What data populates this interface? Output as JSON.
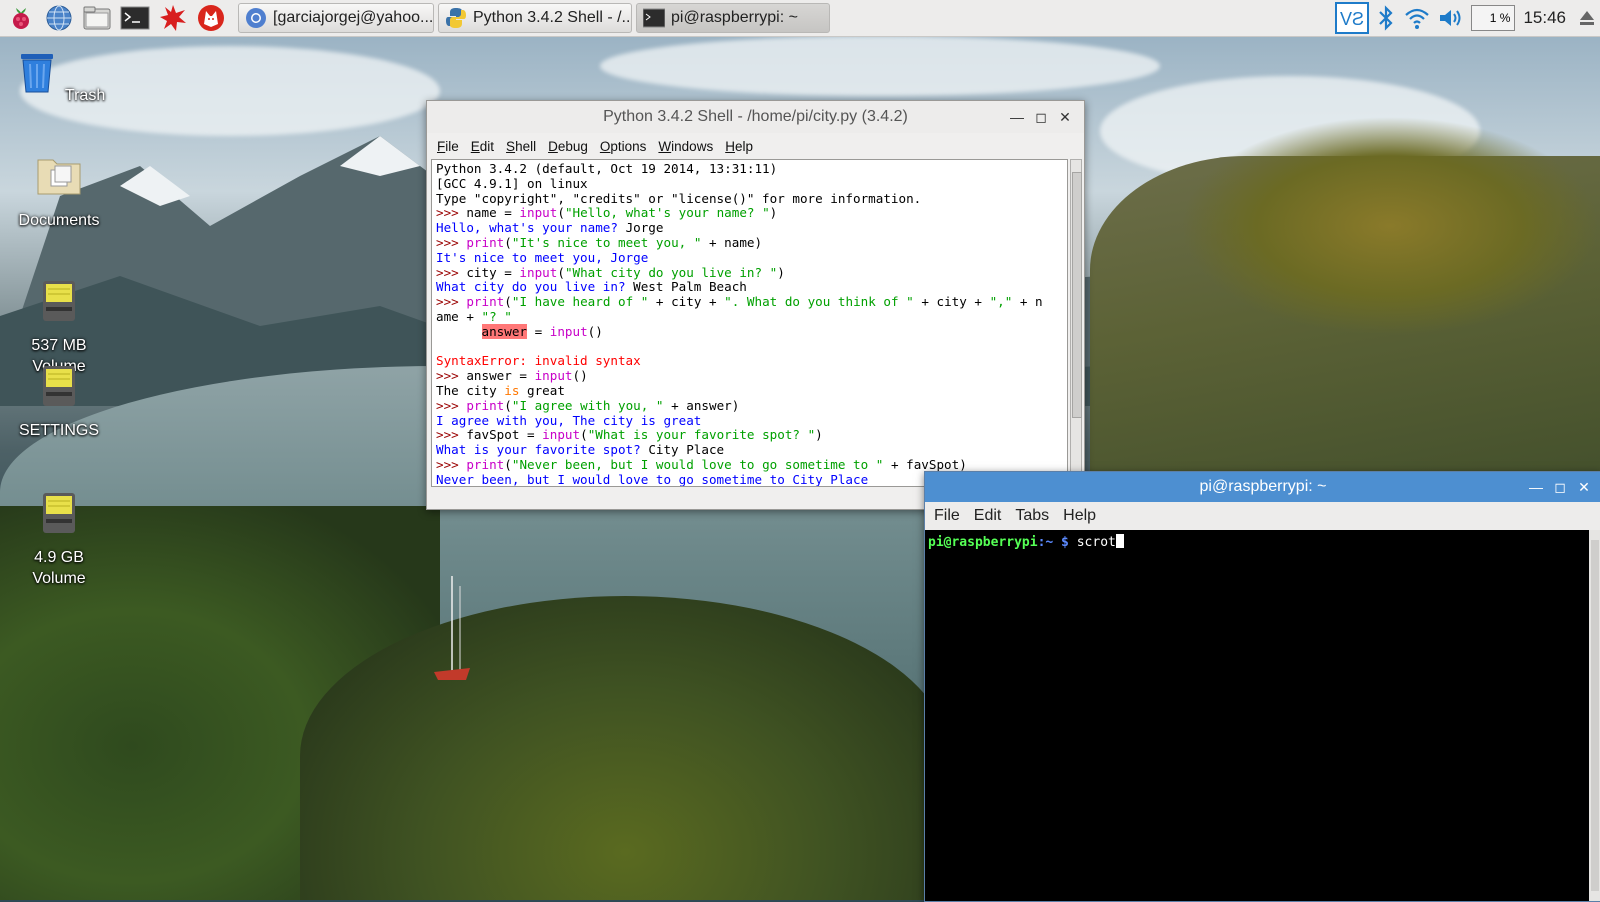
{
  "taskbar": {
    "launchers": [
      "raspberry-menu-icon",
      "web-browser-icon",
      "file-manager-icon",
      "terminal-icon",
      "mathematica-icon",
      "wolfram-icon"
    ],
    "tasks": [
      {
        "label": "[garciajorgej@yahoo...",
        "icon": "chromium-icon"
      },
      {
        "label": "Python 3.4.2 Shell - /...",
        "icon": "python-icon"
      },
      {
        "label": "pi@raspberrypi: ~",
        "icon": "terminal-icon"
      }
    ],
    "tray": {
      "cpu": "1 %",
      "clock": "15:46"
    }
  },
  "desktop_icons": [
    {
      "label": "Trash"
    },
    {
      "label": "Documents"
    },
    {
      "label": "537 MB\nVolume"
    },
    {
      "label": "SETTINGS"
    },
    {
      "label": "4.9 GB\nVolume"
    }
  ],
  "idle": {
    "title": "Python 3.4.2 Shell - /home/pi/city.py (3.4.2)",
    "menu": [
      "File",
      "Edit",
      "Shell",
      "Debug",
      "Options",
      "Windows",
      "Help"
    ],
    "lines": {
      "l1": "Python 3.4.2 (default, Oct 19 2014, 13:31:11)",
      "l2": "[GCC 4.9.1] on linux",
      "l3": "Type \"copyright\", \"credits\" or \"license()\" for more information.",
      "p": ">>> ",
      "l4a": "name = ",
      "l4b": "input",
      "l4c": "(",
      "l4d": "\"Hello, what's your name? \"",
      "l4e": ")",
      "l5a": "Hello, what's your name? ",
      "l5b": "Jorge",
      "l6b": "print",
      "l6c": "(",
      "l6d": "\"It's nice to meet you, \"",
      "l6e": " + name)",
      "l7": "It's nice to meet you, Jorge",
      "l8a": "city = ",
      "l8b": "input",
      "l8c": "(",
      "l8d": "\"What city do you live in? \"",
      "l8e": ")",
      "l9a": "What city do you live in? ",
      "l9b": "West Palm Beach",
      "l10b": "print",
      "l10c": "(",
      "l10d": "\"I have heard of \"",
      "l10e": " + city + ",
      "l10f": "\". What do you think of \"",
      "l10g": " + city + ",
      "l10h": "\",\"",
      "l10i": " + n",
      "l11a": "ame + ",
      "l11b": "\"? \"",
      "l12a": "      ",
      "l12b": "answer",
      "l12c": " = ",
      "l12d": "input",
      "l12e": "()",
      "l13": "",
      "l14": "SyntaxError: invalid syntax",
      "l15a": "answer = ",
      "l15b": "input",
      "l15c": "()",
      "l16a": "The city ",
      "l16b": "is",
      "l16c": " great",
      "l17b": "print",
      "l17c": "(",
      "l17d": "\"I agree with you, \"",
      "l17e": " + answer)",
      "l18": "I agree with you, The city is great",
      "l19a": "favSpot = ",
      "l19b": "input",
      "l19c": "(",
      "l19d": "\"What is your favorite spot? \"",
      "l19e": ")",
      "l20a": "What is your favorite spot? ",
      "l20b": "City Place",
      "l21b": "print",
      "l21c": "(",
      "l21d": "\"Never been, but I would love to go sometime to \"",
      "l21e": " + favSpot)",
      "l22": "Never been, but I would love to go sometime to City Place"
    }
  },
  "terminal": {
    "title": "pi@raspberrypi: ~",
    "menu": [
      "File",
      "Edit",
      "Tabs",
      "Help"
    ],
    "prompt_user": "pi@raspberrypi",
    "prompt_path": ":~ $ ",
    "command": "scrot"
  },
  "colors": {
    "terminal_titlebar": "#4d8fd1",
    "idle_keyword": "#c800c8",
    "idle_string": "#00a000",
    "idle_output": "#0000ff",
    "idle_error": "#ff0000"
  }
}
